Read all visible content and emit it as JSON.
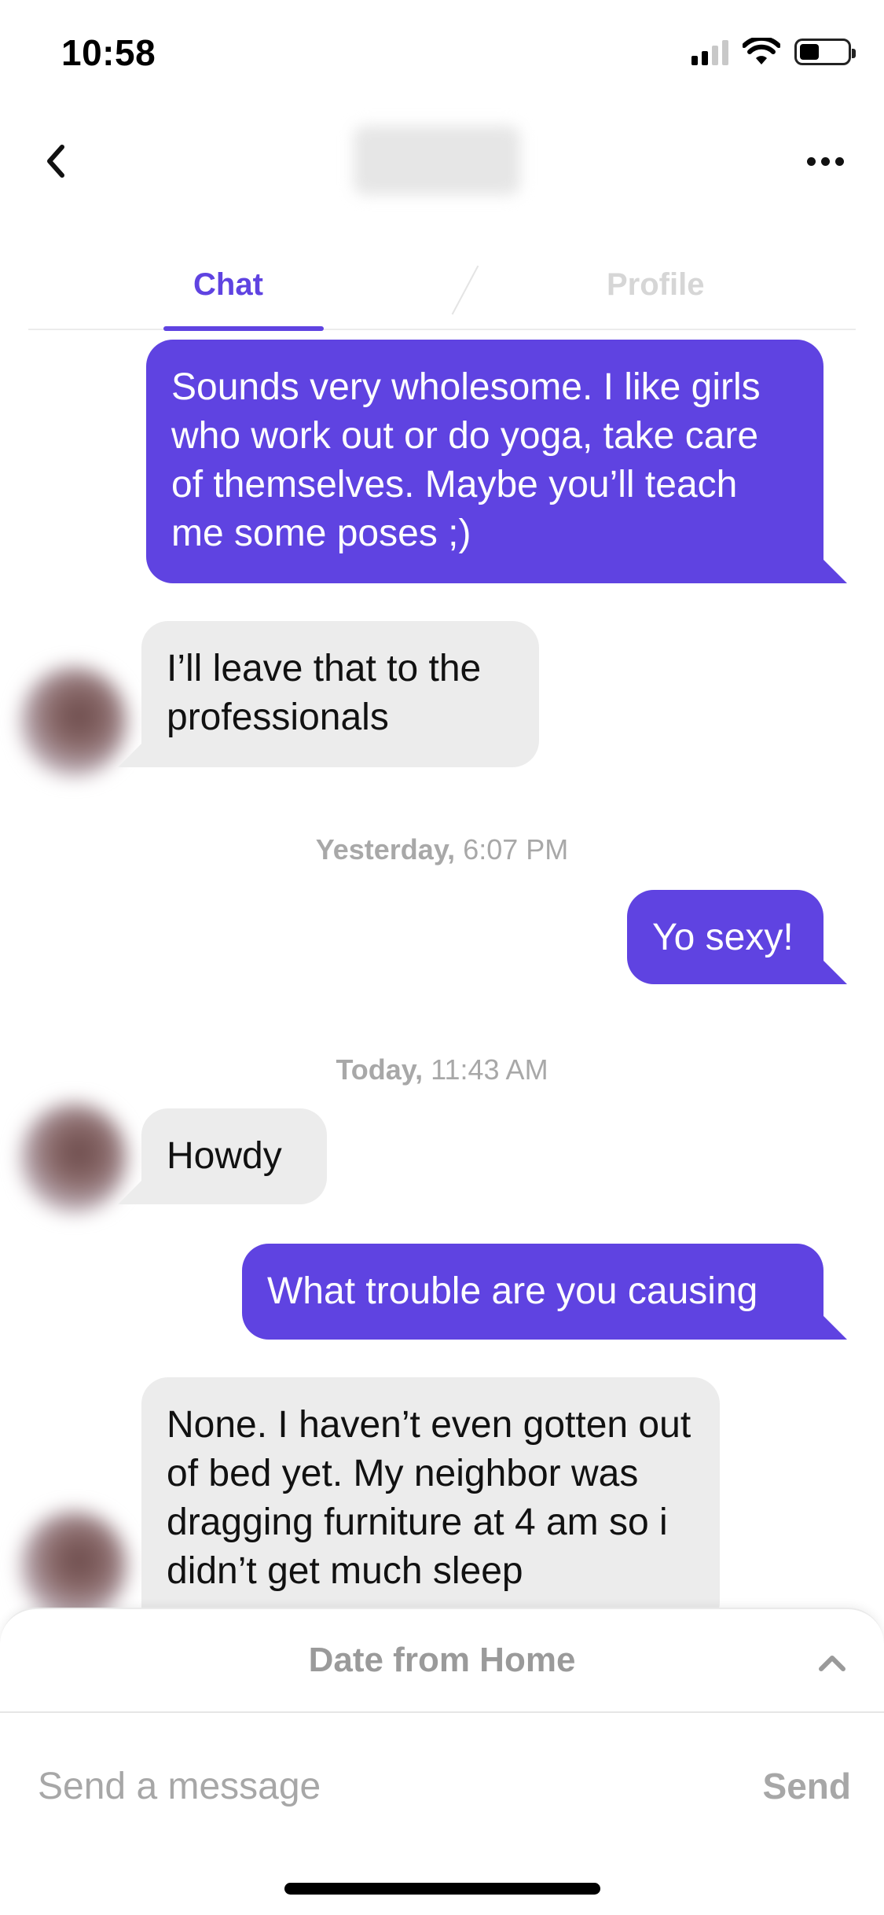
{
  "status_bar": {
    "time": "10:58",
    "icons": [
      "signal-icon",
      "wifi-icon",
      "battery-icon"
    ]
  },
  "header": {
    "back_icon": "chevron-left-icon",
    "more_icon": "more-horizontal-icon"
  },
  "tabs": [
    {
      "label": "Chat",
      "active": true
    },
    {
      "label": "Profile",
      "active": false
    }
  ],
  "messages": [
    {
      "direction": "outgoing",
      "text": "Sounds very wholesome. I like girls who work out or do yoga, take care of themselves. Maybe you’ll teach me some poses ;)"
    },
    {
      "direction": "incoming",
      "text": "I’ll leave that to the professionals"
    },
    {
      "direction": "outgoing",
      "text": "Yo sexy!"
    },
    {
      "direction": "incoming",
      "text": "Howdy"
    },
    {
      "direction": "outgoing",
      "text": "What trouble are you causing"
    },
    {
      "direction": "incoming",
      "text": "None. I haven’t even gotten out of bed yet. My neighbor was dragging furniture at 4 am so i didn’t get much sleep"
    }
  ],
  "timestamps": [
    {
      "day": "Yesterday,",
      "time": "6:07 PM"
    },
    {
      "day": "Today,",
      "time": "11:43 AM"
    }
  ],
  "composer": {
    "panel_title": "Date from Home",
    "placeholder": "Send a message",
    "send_label": "Send"
  },
  "colors": {
    "accent": "#5f43e1",
    "incoming_bubble": "#ececec",
    "muted_text": "#a7a7a7"
  }
}
